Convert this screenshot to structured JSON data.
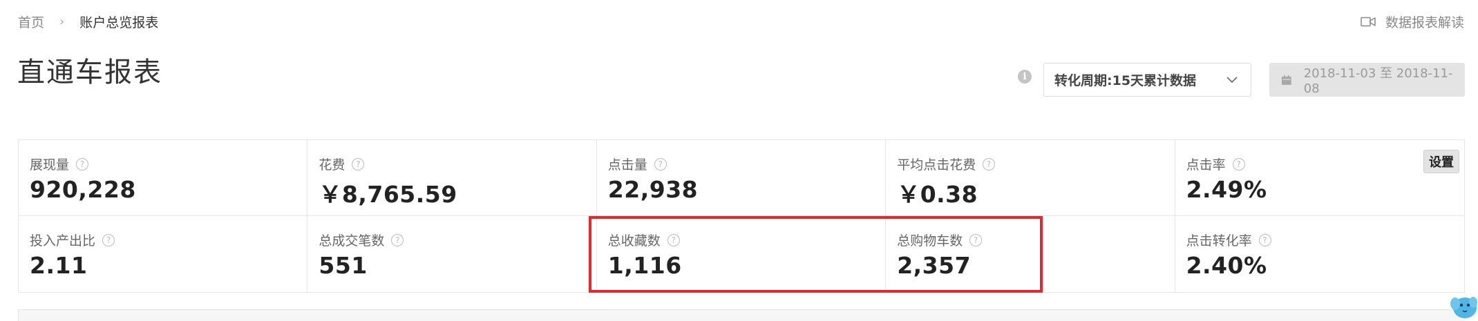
{
  "breadcrumb": {
    "home": "首页",
    "separator": "›",
    "current": "账户总览报表"
  },
  "page_title": "直通车报表",
  "report_guide": {
    "label": "数据报表解读",
    "icon": "video-icon"
  },
  "filters": {
    "info_icon": "i",
    "period_select": "转化周期:15天累计数据",
    "date_range": "2018-11-03 至 2018-11-08"
  },
  "metrics": [
    {
      "label": "展现量",
      "value": "920,228"
    },
    {
      "label": "花费",
      "value": "￥8,765.59"
    },
    {
      "label": "点击量",
      "value": "22,938"
    },
    {
      "label": "平均点击花费",
      "value": "￥0.38"
    },
    {
      "label": "点击率",
      "value": "2.49%"
    },
    {
      "label": "投入产出比",
      "value": "2.11"
    },
    {
      "label": "总成交笔数",
      "value": "551"
    },
    {
      "label": "总收藏数",
      "value": "1,116"
    },
    {
      "label": "总购物车数",
      "value": "2,357"
    },
    {
      "label": "点击转化率",
      "value": "2.40%"
    }
  ],
  "settings_label": "设置",
  "question_icon": "?",
  "colors": {
    "highlight": "#e8262c",
    "mascot": "#4fb6e6"
  }
}
